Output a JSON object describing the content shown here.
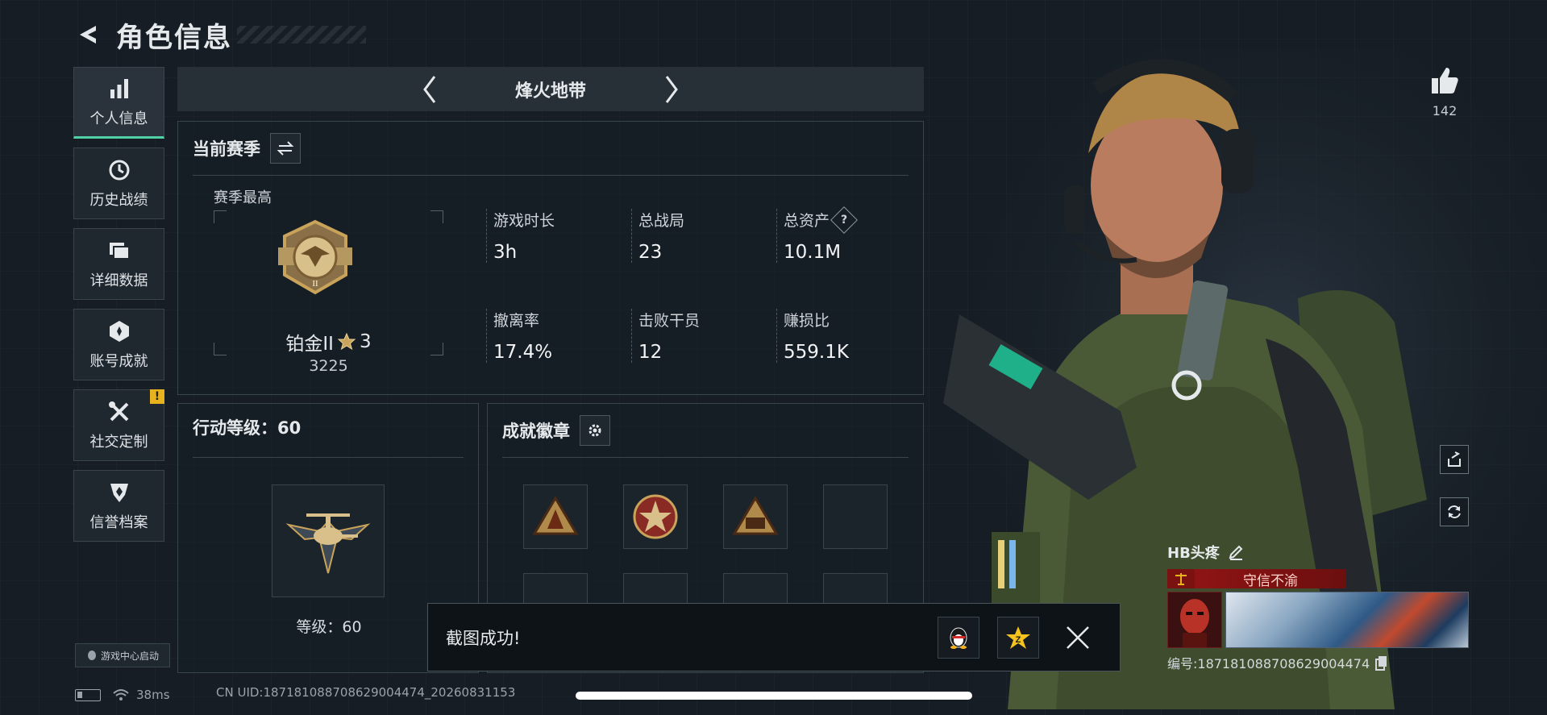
{
  "header": {
    "title": "角色信息"
  },
  "sidebar": {
    "items": [
      {
        "label": "个人信息",
        "icon": "bar-chart-icon",
        "active": true
      },
      {
        "label": "历史战绩",
        "icon": "clock-icon"
      },
      {
        "label": "详细数据",
        "icon": "folder-icon"
      },
      {
        "label": "账号成就",
        "icon": "achievement-icon"
      },
      {
        "label": "社交定制",
        "icon": "tools-icon",
        "alert": "!"
      },
      {
        "label": "信誉档案",
        "icon": "credit-shield-icon"
      }
    ],
    "launch_label": "游戏中心启动"
  },
  "mode": {
    "name": "烽火地带"
  },
  "season": {
    "title": "当前赛季",
    "best_label": "赛季最高",
    "rank_name": "铂金II",
    "rank_stars": "3",
    "rank_score": "3225",
    "stats": [
      {
        "label": "游戏时长",
        "value": "3h"
      },
      {
        "label": "总战局",
        "value": "23"
      },
      {
        "label": "总资产",
        "value": "10.1M",
        "help": "?"
      },
      {
        "label": "撤离率",
        "value": "17.4%"
      },
      {
        "label": "击败干员",
        "value": "12"
      },
      {
        "label": "赚损比",
        "value": "559.1K"
      }
    ]
  },
  "level": {
    "title": "行动等级：60",
    "level_text": "等级：60"
  },
  "badges": {
    "title": "成就徽章",
    "slots": 8,
    "filled": 3
  },
  "toast": {
    "message": "截图成功!"
  },
  "status": {
    "ping": "38ms",
    "uid": "CN UID:187181088708629004474_20260831153"
  },
  "player": {
    "likes": "142",
    "name": "HB头疼",
    "trait": "守信不渝",
    "id": "编号:187181088708629004474"
  },
  "colors": {
    "accent": "#4fd1a5",
    "warning": "#e8b21e",
    "trait_red": "#8e1414",
    "gold": "#c9a35a"
  }
}
